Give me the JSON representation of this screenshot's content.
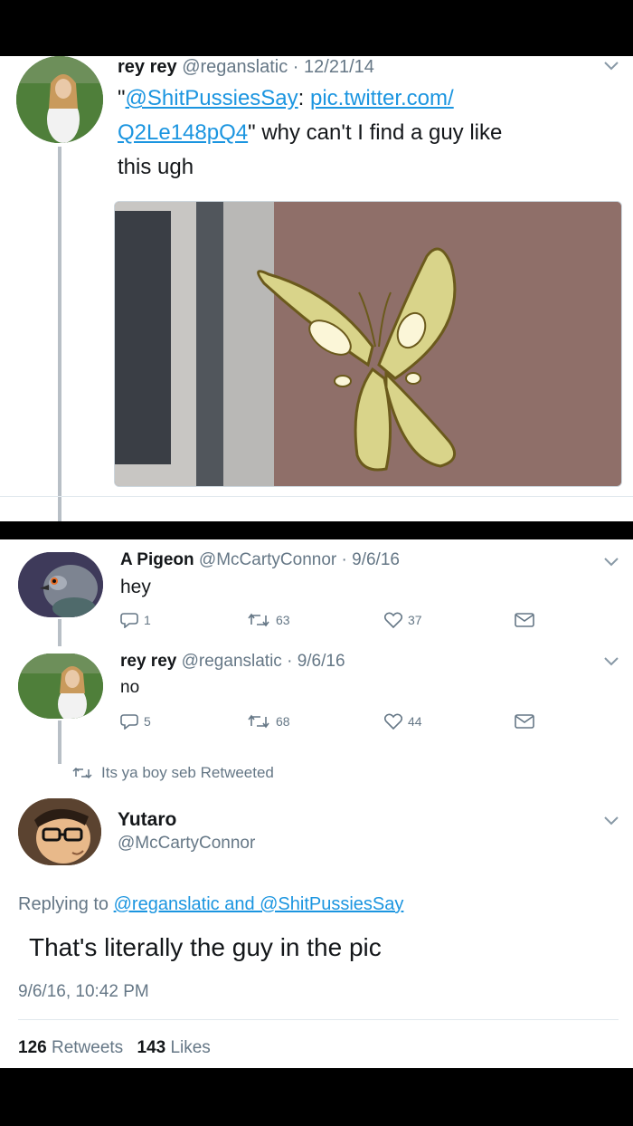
{
  "tweet1": {
    "name": "rey rey",
    "handle": "@reganslatic",
    "date": "12/21/14",
    "quote_open": "\"",
    "mention": "@ShitPussiesSay",
    "colon": ":",
    "link1": "pic.twitter.com/",
    "link2": "Q2Le148pQ4",
    "text_tail": "\" why can't I find a guy like",
    "text_line3": "this ugh"
  },
  "tweet2": {
    "name": "A Pigeon",
    "handle": "@McCartyConnor",
    "date": "9/6/16",
    "text": "hey",
    "replies": "1",
    "retweets": "63",
    "likes": "37"
  },
  "tweet3": {
    "name": "rey rey",
    "handle": "@reganslatic",
    "date": "9/6/16",
    "text": "no",
    "replies": "5",
    "retweets": "68",
    "likes": "44"
  },
  "retweet_banner": "Its ya boy seb Retweeted",
  "tweet4": {
    "name": "Yutaro",
    "handle": "@McCartyConnor",
    "replying_prefix": "Replying to",
    "replying_targets": "@reganslatic and @ShitPussiesSay",
    "text": "That's literally the guy in the pic",
    "timestamp": "9/6/16, 10:42 PM",
    "retweet_count": "126",
    "retweet_label": "Retweets",
    "like_count": "143",
    "like_label": "Likes"
  },
  "separator_dot": "·",
  "colors": {
    "link": "#1b95e0",
    "muted": "#657786",
    "text": "#14171a"
  }
}
